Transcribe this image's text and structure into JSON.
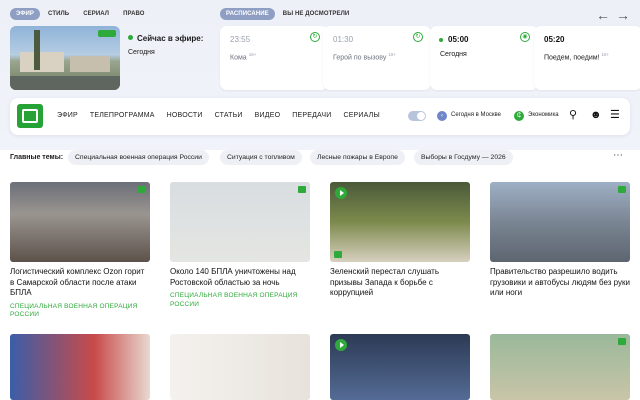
{
  "top": {
    "tabs_left": [
      "ЭФИР",
      "СТИЛЬ",
      "СЕРИАЛ",
      "ПРАВО"
    ],
    "tabs_right": [
      "РАСПИСАНИЕ",
      "ВЫ НЕ ДОСМОТРЕЛИ"
    ],
    "onair_label": "Сейчас в эфире:",
    "onair_program": "Сегодня",
    "schedule": [
      {
        "time": "23:55",
        "title": "Кома",
        "age": "16+",
        "state": "past"
      },
      {
        "time": "01:30",
        "title": "Герой по вызову",
        "age": "16+",
        "state": "past"
      },
      {
        "time": "05:00",
        "title": "Сегодня",
        "age": "",
        "state": "current"
      },
      {
        "time": "05:20",
        "title": "Поедем, поедим!",
        "age": "16+",
        "state": "next"
      }
    ]
  },
  "nav": {
    "items": [
      "ЭФИР",
      "ТЕЛЕПРОГРАММА",
      "НОВОСТИ",
      "СТАТЬИ",
      "ВИДЕО",
      "ПЕРЕДАЧИ",
      "СЕРИАЛЫ"
    ],
    "today_moscow": "Сегодня в Москве",
    "economy": "Экономика"
  },
  "topics": {
    "label": "Главные темы:",
    "items": [
      "Специальная военная операция России",
      "Ситуация с топливом",
      "Лесные пожары в Европе",
      "Выборы в Госдуму — 2026"
    ]
  },
  "news": [
    {
      "headline": "Логистический комплекс Ozon горит в Самарской области после атаки БПЛА",
      "rubric": "СПЕЦИАЛЬНАЯ ВОЕННАЯ ОПЕРАЦИЯ РОССИИ"
    },
    {
      "headline": "Около 140 БПЛА уничтожены над Ростовской областью за ночь",
      "rubric": "СПЕЦИАЛЬНАЯ ВОЕННАЯ ОПЕРАЦИЯ РОССИИ"
    },
    {
      "headline": "Зеленский перестал слушать призывы Запада к борьбе с коррупцией",
      "rubric": ""
    },
    {
      "headline": "Правительство разрешило водить грузовики и автобусы людям без руки или ноги",
      "rubric": ""
    }
  ],
  "colors": {
    "accent": "#2eaa3a",
    "pill_active": "#8f9fc4",
    "background_top": "#eef0f8"
  }
}
